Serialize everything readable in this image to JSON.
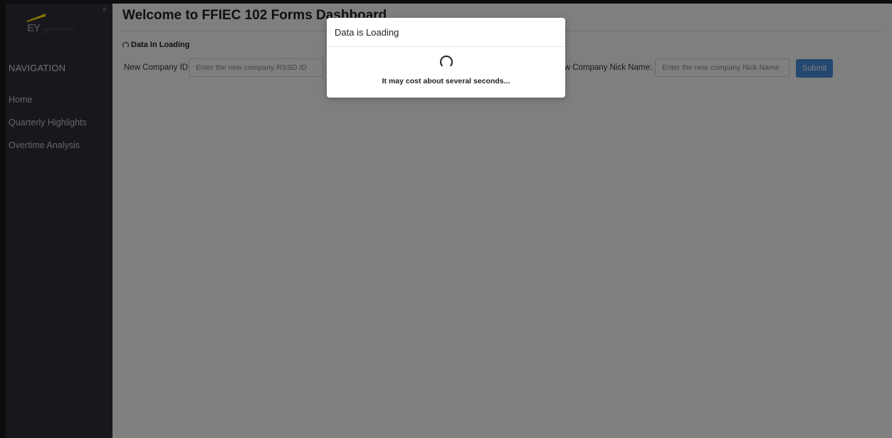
{
  "sidebar": {
    "collapse_symbol": "<",
    "logo_letters": "EY",
    "logo_tagline": "Building a better working world",
    "nav_heading": "NAVIGATION",
    "items": [
      {
        "label": "Home"
      },
      {
        "label": "Quarterly Highlights"
      },
      {
        "label": "Overtime Analysis"
      }
    ]
  },
  "main": {
    "title": "Welcome to FFIEC 102 Forms Dashboard",
    "loading_status": "Data In Loading",
    "form": {
      "company_id_label": "New Company ID:",
      "company_id_placeholder": "Enter the new company RSSD ID",
      "nick_name_label": "New Company Nick Name:",
      "nick_name_placeholder": "Enter the new company Nick Name",
      "submit_label": "Submit"
    }
  },
  "modal": {
    "title": "Data is Loading",
    "message": "It may cost about several seconds..."
  },
  "colors": {
    "sidebar_bg": "#2e2e38",
    "logo_accent": "#ffe600",
    "submit_bg": "#4a90e2",
    "overlay": "rgba(0,0,0,0.5)"
  },
  "icons": {
    "logo_mark": "ey-beam-icon",
    "loading": "spinner-icon"
  }
}
